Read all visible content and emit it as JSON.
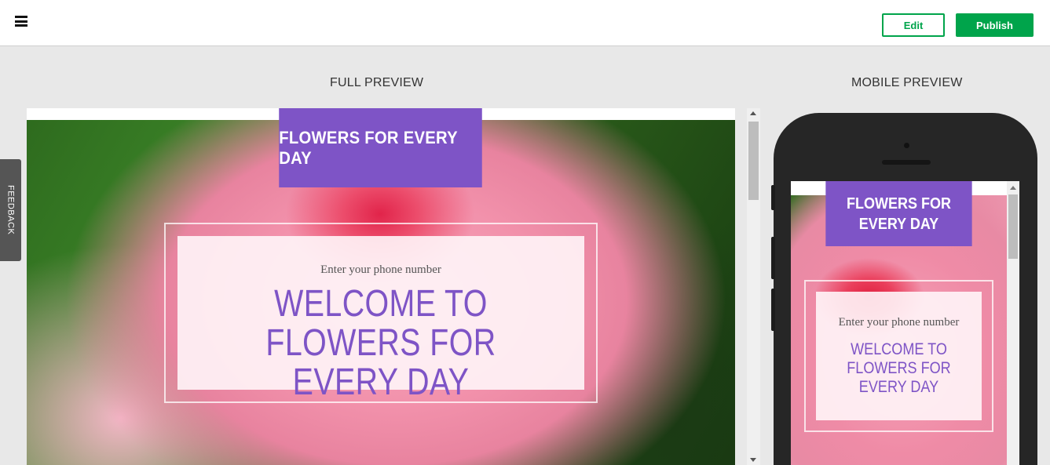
{
  "topbar": {
    "menu_icon": "hamburger-icon",
    "edit_label": "Edit",
    "publish_label": "Publish"
  },
  "labels": {
    "full_preview": "FULL PREVIEW",
    "mobile_preview": "MOBILE PREVIEW"
  },
  "feedback_label": "FEEDBACK",
  "site": {
    "banner_title": "FLOWERS FOR EVERY DAY",
    "phone_placeholder": "Enter your phone number",
    "welcome_heading": "WELCOME TO FLOWERS FOR EVERY DAY"
  },
  "colors": {
    "accent_green": "#00a44b",
    "brand_purple": "#7e54c6"
  }
}
